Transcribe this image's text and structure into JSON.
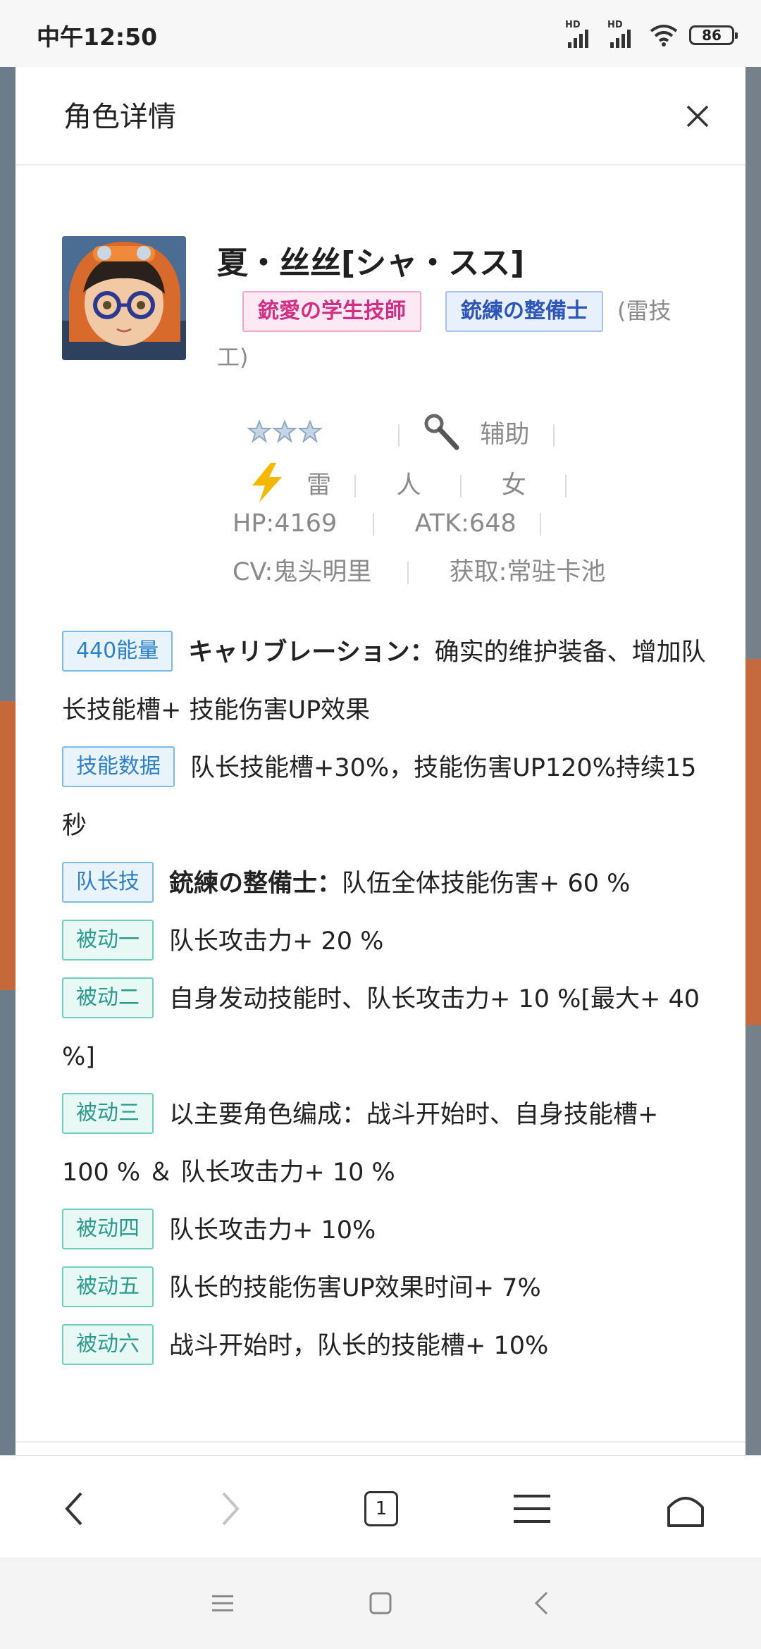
{
  "status_bar": {
    "time": "中午12:50",
    "battery": "86",
    "network_label": "HD"
  },
  "modal": {
    "title": "角色详情",
    "character": {
      "name": "夏・丝丝[シャ・スス]",
      "tag1": "銃愛の学生技師",
      "tag2": "銃練の整備士",
      "tag_note_1": "(雷技",
      "tag_note_2": "工)",
      "role": "辅助",
      "element": "雷",
      "race": "人",
      "gender": "女",
      "hp": "HP:4169",
      "atk": "ATK:648",
      "cv": "CV:鬼头明里",
      "source": "获取:常驻卡池",
      "stars": 3
    },
    "skills": [
      {
        "badge": "440能量",
        "title": "キャリブレーション：",
        "text": "确实的维护装备、增加队长技能槽+ 技能伤害UP效果",
        "badge_style": "blue"
      },
      {
        "badge": "技能数据",
        "title": "",
        "text": "队长技能槽+30%，技能伤害UP120%持续15秒",
        "badge_style": "blue"
      },
      {
        "badge": "队长技",
        "title": "銃練の整備士：",
        "text": "队伍全体技能伤害+ 60 %",
        "badge_style": "blue"
      },
      {
        "badge": "被动一",
        "title": "",
        "text": "队长攻击力+ 20 %",
        "badge_style": "green"
      },
      {
        "badge": "被动二",
        "title": "",
        "text": "自身发动技能时、队长攻击力+ 10 %[最大+ 40 %]",
        "badge_style": "green"
      },
      {
        "badge": "被动三",
        "title": "",
        "text": "以主要角色编成：战斗开始时、自身技能槽+ 100 % ＆ 队长攻击力+ 10 %",
        "badge_style": "green"
      },
      {
        "badge": "被动四",
        "title": "",
        "text": "队长攻击力+ 10%",
        "badge_style": "green"
      },
      {
        "badge": "被动五",
        "title": "",
        "text": "队长的技能伤害UP效果时间+ 7%",
        "badge_style": "green"
      },
      {
        "badge": "被动六",
        "title": "",
        "text": "战斗开始时，队长的技能槽+ 10%",
        "badge_style": "green"
      }
    ]
  },
  "browser_nav": {
    "tab_count": "1"
  },
  "colors": {
    "accent_blue": "#2d7fc8",
    "accent_green": "#2a9a8d",
    "pink": "#d22f84",
    "tag_blue": "#2c55b8"
  }
}
